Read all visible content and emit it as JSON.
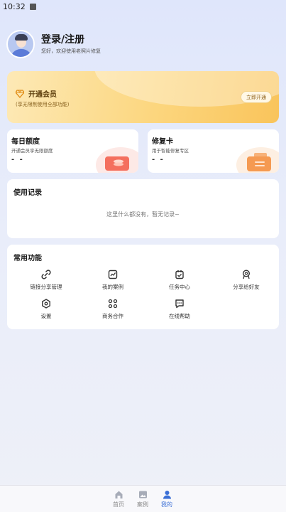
{
  "status_bar": {
    "time": "10:32"
  },
  "profile": {
    "title": "登录/注册",
    "subtitle": "您好，欢迎使用老照片修复"
  },
  "vip": {
    "title": "开通会员",
    "subtitle": "(享无限制使用全部功能)",
    "button": "立即开通"
  },
  "daily_quota": {
    "title": "每日额度",
    "subtitle": "开通会员享无限额度",
    "value": "- -"
  },
  "repair_card": {
    "title": "修复卡",
    "subtitle": "用于智能修复专区",
    "value": "- -"
  },
  "usage": {
    "title": "使用记录",
    "empty": "这里什么都没有，暂无记录~"
  },
  "functions": {
    "title": "常用功能",
    "items": [
      {
        "label": "链接分享管理",
        "icon": "link-icon"
      },
      {
        "label": "我的案例",
        "icon": "chart-icon"
      },
      {
        "label": "任务中心",
        "icon": "task-icon"
      },
      {
        "label": "分享给好友",
        "icon": "share-icon"
      },
      {
        "label": "设置",
        "icon": "settings-icon"
      },
      {
        "label": "商务合作",
        "icon": "cooperation-icon"
      },
      {
        "label": "在线帮助",
        "icon": "help-icon"
      }
    ]
  },
  "nav": {
    "items": [
      {
        "label": "首页",
        "icon": "home-icon",
        "active": false
      },
      {
        "label": "案例",
        "icon": "gallery-icon",
        "active": false
      },
      {
        "label": "我的",
        "icon": "user-icon",
        "active": true
      }
    ]
  },
  "colors": {
    "accent": "#3b6fd6",
    "vip_gold": "#f9c45b"
  }
}
